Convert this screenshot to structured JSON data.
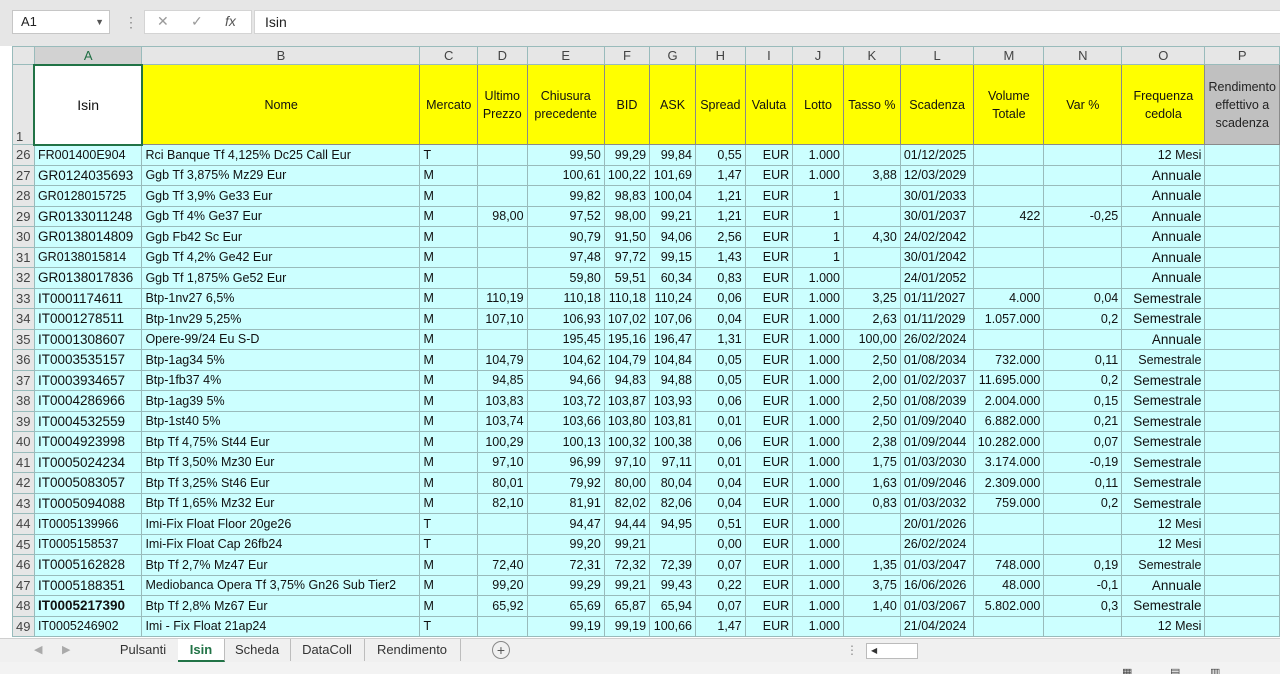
{
  "formula_bar": {
    "name_box": "A1",
    "cancel_glyph": "✕",
    "enter_glyph": "✓",
    "fx_glyph": "fx",
    "content": "Isin"
  },
  "columns": [
    "A",
    "B",
    "C",
    "D",
    "E",
    "F",
    "G",
    "H",
    "I",
    "J",
    "K",
    "L",
    "M",
    "N",
    "O",
    "P"
  ],
  "header_row": {
    "row_number": "1",
    "cells": [
      "Isin",
      "Nome",
      "Mercato",
      "Ultimo Prezzo",
      "Chiusura precedente",
      "BID",
      "ASK",
      "Spread",
      "Valuta",
      "Lotto",
      "Tasso %",
      "Scadenza",
      "Volume Totale",
      "Var %",
      "Frequenza cedola",
      "Rendimento effettivo a scadenza"
    ]
  },
  "rows": [
    {
      "n": "26",
      "isin": "FR001400E904",
      "nome": "Rci Banque Tf 4,125% Dc25 Call Eur",
      "mercato": "T",
      "ultimo": "",
      "chiusura": "99,50",
      "bid": "99,29",
      "ask": "99,84",
      "spread": "0,55",
      "valuta": "EUR",
      "lotto": "1.000",
      "tasso": "",
      "scadenza": "01/12/2025",
      "volume": "",
      "var": "",
      "freq": "12 Mesi"
    },
    {
      "n": "27",
      "isin": "GR0124035693",
      "nome": "Ggb Tf 3,875% Mz29 Eur",
      "mercato": "M",
      "ultimo": "",
      "chiusura": "100,61",
      "bid": "100,22",
      "ask": "101,69",
      "spread": "1,47",
      "valuta": "EUR",
      "lotto": "1.000",
      "tasso": "3,88",
      "scadenza": "12/03/2029",
      "volume": "",
      "var": "",
      "freq": "Annuale"
    },
    {
      "n": "28",
      "isin": "GR0128015725",
      "nome": "Ggb Tf 3,9% Ge33 Eur",
      "mercato": "M",
      "ultimo": "",
      "chiusura": "99,82",
      "bid": "98,83",
      "ask": "100,04",
      "spread": "1,21",
      "valuta": "EUR",
      "lotto": "1",
      "tasso": "",
      "scadenza": "30/01/2033",
      "volume": "",
      "var": "",
      "freq": "Annuale"
    },
    {
      "n": "29",
      "isin": "GR0133011248",
      "nome": "Ggb Tf 4% Ge37 Eur",
      "mercato": "M",
      "ultimo": "98,00",
      "chiusura": "97,52",
      "bid": "98,00",
      "ask": "99,21",
      "spread": "1,21",
      "valuta": "EUR",
      "lotto": "1",
      "tasso": "",
      "scadenza": "30/01/2037",
      "volume": "422",
      "var": "-0,25",
      "freq": "Annuale"
    },
    {
      "n": "30",
      "isin": "GR0138014809",
      "nome": "Ggb Fb42 Sc Eur",
      "mercato": "M",
      "ultimo": "",
      "chiusura": "90,79",
      "bid": "91,50",
      "ask": "94,06",
      "spread": "2,56",
      "valuta": "EUR",
      "lotto": "1",
      "tasso": "4,30",
      "scadenza": "24/02/2042",
      "volume": "",
      "var": "",
      "freq": "Annuale"
    },
    {
      "n": "31",
      "isin": "GR0138015814",
      "nome": "Ggb Tf 4,2% Ge42 Eur",
      "mercato": "M",
      "ultimo": "",
      "chiusura": "97,48",
      "bid": "97,72",
      "ask": "99,15",
      "spread": "1,43",
      "valuta": "EUR",
      "lotto": "1",
      "tasso": "",
      "scadenza": "30/01/2042",
      "volume": "",
      "var": "",
      "freq": "Annuale"
    },
    {
      "n": "32",
      "isin": "GR0138017836",
      "nome": "Ggb Tf 1,875% Ge52 Eur",
      "mercato": "M",
      "ultimo": "",
      "chiusura": "59,80",
      "bid": "59,51",
      "ask": "60,34",
      "spread": "0,83",
      "valuta": "EUR",
      "lotto": "1.000",
      "tasso": "",
      "scadenza": "24/01/2052",
      "volume": "",
      "var": "",
      "freq": "Annuale"
    },
    {
      "n": "33",
      "isin": "IT0001174611",
      "nome": "Btp-1nv27 6,5%",
      "mercato": "M",
      "ultimo": "110,19",
      "chiusura": "110,18",
      "bid": "110,18",
      "ask": "110,24",
      "spread": "0,06",
      "valuta": "EUR",
      "lotto": "1.000",
      "tasso": "3,25",
      "scadenza": "01/11/2027",
      "volume": "4.000",
      "var": "0,04",
      "freq": "Semestrale"
    },
    {
      "n": "34",
      "isin": "IT0001278511",
      "nome": "Btp-1nv29 5,25%",
      "mercato": "M",
      "ultimo": "107,10",
      "chiusura": "106,93",
      "bid": "107,02",
      "ask": "107,06",
      "spread": "0,04",
      "valuta": "EUR",
      "lotto": "1.000",
      "tasso": "2,63",
      "scadenza": "01/11/2029",
      "volume": "1.057.000",
      "var": "0,2",
      "freq": "Semestrale"
    },
    {
      "n": "35",
      "isin": "IT0001308607",
      "nome": "Opere-99/24 Eu S-D",
      "mercato": "M",
      "ultimo": "",
      "chiusura": "195,45",
      "bid": "195,16",
      "ask": "196,47",
      "spread": "1,31",
      "valuta": "EUR",
      "lotto": "1.000",
      "tasso": "100,00",
      "scadenza": "26/02/2024",
      "volume": "",
      "var": "",
      "freq": "Annuale"
    },
    {
      "n": "36",
      "isin": "IT0003535157",
      "nome": "Btp-1ag34 5%",
      "mercato": "M",
      "ultimo": "104,79",
      "chiusura": "104,62",
      "bid": "104,79",
      "ask": "104,84",
      "spread": "0,05",
      "valuta": "EUR",
      "lotto": "1.000",
      "tasso": "2,50",
      "scadenza": "01/08/2034",
      "volume": "732.000",
      "var": "0,11",
      "freq": "Semestrale"
    },
    {
      "n": "37",
      "isin": "IT0003934657",
      "nome": "Btp-1fb37 4%",
      "mercato": "M",
      "ultimo": "94,85",
      "chiusura": "94,66",
      "bid": "94,83",
      "ask": "94,88",
      "spread": "0,05",
      "valuta": "EUR",
      "lotto": "1.000",
      "tasso": "2,00",
      "scadenza": "01/02/2037",
      "volume": "11.695.000",
      "var": "0,2",
      "freq": "Semestrale"
    },
    {
      "n": "38",
      "isin": "IT0004286966",
      "nome": "Btp-1ag39 5%",
      "mercato": "M",
      "ultimo": "103,83",
      "chiusura": "103,72",
      "bid": "103,87",
      "ask": "103,93",
      "spread": "0,06",
      "valuta": "EUR",
      "lotto": "1.000",
      "tasso": "2,50",
      "scadenza": "01/08/2039",
      "volume": "2.004.000",
      "var": "0,15",
      "freq": "Semestrale"
    },
    {
      "n": "39",
      "isin": "IT0004532559",
      "nome": "Btp-1st40 5%",
      "mercato": "M",
      "ultimo": "103,74",
      "chiusura": "103,66",
      "bid": "103,80",
      "ask": "103,81",
      "spread": "0,01",
      "valuta": "EUR",
      "lotto": "1.000",
      "tasso": "2,50",
      "scadenza": "01/09/2040",
      "volume": "6.882.000",
      "var": "0,21",
      "freq": "Semestrale"
    },
    {
      "n": "40",
      "isin": "IT0004923998",
      "nome": "Btp Tf 4,75% St44 Eur",
      "mercato": "M",
      "ultimo": "100,29",
      "chiusura": "100,13",
      "bid": "100,32",
      "ask": "100,38",
      "spread": "0,06",
      "valuta": "EUR",
      "lotto": "1.000",
      "tasso": "2,38",
      "scadenza": "01/09/2044",
      "volume": "10.282.000",
      "var": "0,07",
      "freq": "Semestrale"
    },
    {
      "n": "41",
      "isin": "IT0005024234",
      "nome": "Btp Tf 3,50% Mz30 Eur",
      "mercato": "M",
      "ultimo": "97,10",
      "chiusura": "96,99",
      "bid": "97,10",
      "ask": "97,11",
      "spread": "0,01",
      "valuta": "EUR",
      "lotto": "1.000",
      "tasso": "1,75",
      "scadenza": "01/03/2030",
      "volume": "3.174.000",
      "var": "-0,19",
      "freq": "Semestrale"
    },
    {
      "n": "42",
      "isin": "IT0005083057",
      "nome": "Btp Tf 3,25% St46 Eur",
      "mercato": "M",
      "ultimo": "80,01",
      "chiusura": "79,92",
      "bid": "80,00",
      "ask": "80,04",
      "spread": "0,04",
      "valuta": "EUR",
      "lotto": "1.000",
      "tasso": "1,63",
      "scadenza": "01/09/2046",
      "volume": "2.309.000",
      "var": "0,11",
      "freq": "Semestrale"
    },
    {
      "n": "43",
      "isin": "IT0005094088",
      "nome": "Btp Tf 1,65% Mz32 Eur",
      "mercato": "M",
      "ultimo": "82,10",
      "chiusura": "81,91",
      "bid": "82,02",
      "ask": "82,06",
      "spread": "0,04",
      "valuta": "EUR",
      "lotto": "1.000",
      "tasso": "0,83",
      "scadenza": "01/03/2032",
      "volume": "759.000",
      "var": "0,2",
      "freq": "Semestrale"
    },
    {
      "n": "44",
      "isin": "IT0005139966",
      "nome": "Imi-Fix Float Floor 20ge26",
      "mercato": "T",
      "ultimo": "",
      "chiusura": "94,47",
      "bid": "94,44",
      "ask": "94,95",
      "spread": "0,51",
      "valuta": "EUR",
      "lotto": "1.000",
      "tasso": "",
      "scadenza": "20/01/2026",
      "volume": "",
      "var": "",
      "freq": "12 Mesi"
    },
    {
      "n": "45",
      "isin": "IT0005158537",
      "nome": "Imi-Fix Float Cap 26fb24",
      "mercato": "T",
      "ultimo": "",
      "chiusura": "99,20",
      "bid": "99,21",
      "ask": "",
      "spread": "0,00",
      "valuta": "EUR",
      "lotto": "1.000",
      "tasso": "",
      "scadenza": "26/02/2024",
      "volume": "",
      "var": "",
      "freq": "12 Mesi"
    },
    {
      "n": "46",
      "isin": "IT0005162828",
      "nome": "Btp Tf 2,7% Mz47 Eur",
      "mercato": "M",
      "ultimo": "72,40",
      "chiusura": "72,31",
      "bid": "72,32",
      "ask": "72,39",
      "spread": "0,07",
      "valuta": "EUR",
      "lotto": "1.000",
      "tasso": "1,35",
      "scadenza": "01/03/2047",
      "volume": "748.000",
      "var": "0,19",
      "freq": "Semestrale"
    },
    {
      "n": "47",
      "isin": "IT0005188351",
      "nome": "Mediobanca Opera Tf 3,75% Gn26 Sub Tier2",
      "mercato": "M",
      "ultimo": "99,20",
      "chiusura": "99,29",
      "bid": "99,21",
      "ask": "99,43",
      "spread": "0,22",
      "valuta": "EUR",
      "lotto": "1.000",
      "tasso": "3,75",
      "scadenza": "16/06/2026",
      "volume": "48.000",
      "var": "-0,1",
      "freq": "Annuale"
    },
    {
      "n": "48",
      "isin": "IT0005217390",
      "nome": "Btp Tf 2,8% Mz67 Eur",
      "mercato": "M",
      "ultimo": "65,92",
      "chiusura": "65,69",
      "bid": "65,87",
      "ask": "65,94",
      "spread": "0,07",
      "valuta": "EUR",
      "lotto": "1.000",
      "tasso": "1,40",
      "scadenza": "01/03/2067",
      "volume": "5.802.000",
      "var": "0,3",
      "freq": "Semestrale"
    },
    {
      "n": "49",
      "isin": "IT0005246902",
      "nome": "Imi - Fix Float 21ap24",
      "mercato": "T",
      "ultimo": "",
      "chiusura": "99,19",
      "bid": "99,19",
      "ask": "100,66",
      "spread": "1,47",
      "valuta": "EUR",
      "lotto": "1.000",
      "tasso": "",
      "scadenza": "21/04/2024",
      "volume": "",
      "var": "",
      "freq": "12 Mesi"
    }
  ],
  "sheet_tabs": [
    {
      "label": "Pulsanti",
      "active": false
    },
    {
      "label": "Isin",
      "active": true
    },
    {
      "label": "Scheda",
      "active": false
    },
    {
      "label": "DataColl",
      "active": false
    },
    {
      "label": "Rendimento",
      "active": false
    }
  ],
  "add_sheet_glyph": "+",
  "colors": {
    "header_yellow": "#ffff00",
    "data_cyan": "#ccffff",
    "excel_green": "#217346",
    "header_grey": "#c0c0c0"
  }
}
